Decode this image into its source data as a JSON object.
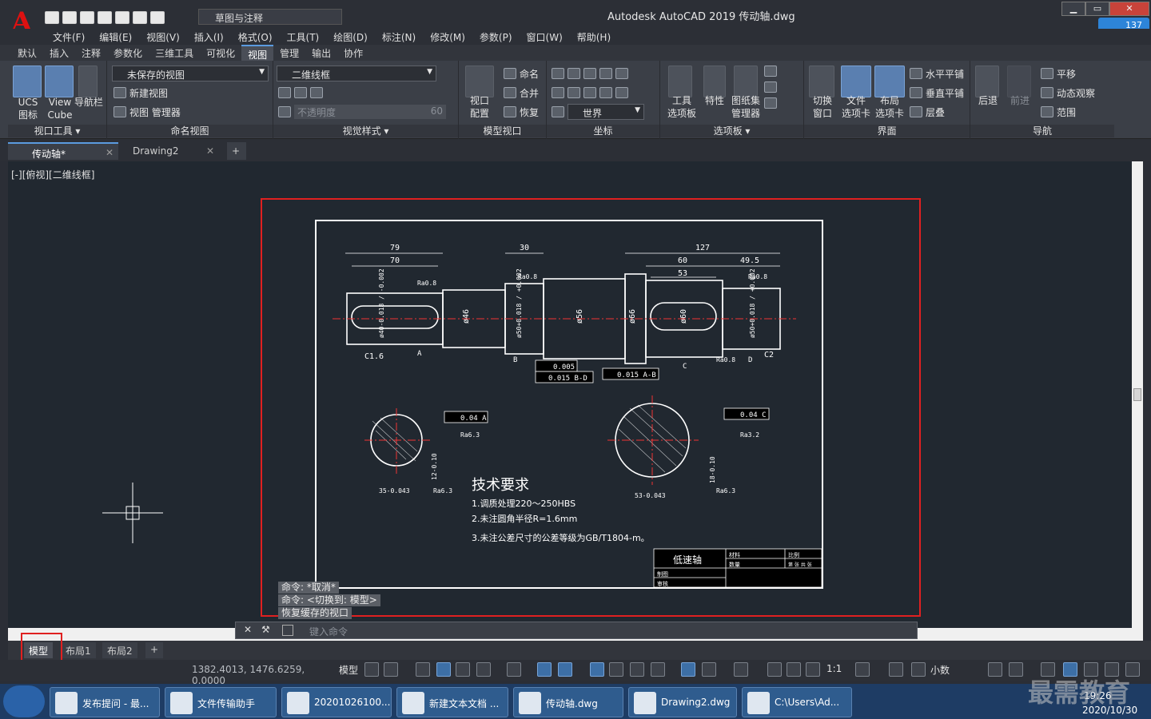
{
  "app": {
    "logo": "A",
    "workspace": "草图与注释",
    "title": "Autodesk AutoCAD 2019    传动轴.dwg",
    "cloud_count": "137"
  },
  "menu": [
    "文件(F)",
    "编辑(E)",
    "视图(V)",
    "插入(I)",
    "格式(O)",
    "工具(T)",
    "绘图(D)",
    "标注(N)",
    "修改(M)",
    "参数(P)",
    "窗口(W)",
    "帮助(H)"
  ],
  "ribbon_tabs": [
    "默认",
    "插入",
    "注释",
    "参数化",
    "三维工具",
    "可视化",
    "视图",
    "管理",
    "输出",
    "协作"
  ],
  "ribbon": {
    "viewport_tools": {
      "title": "视口工具 ▾",
      "ucs1": "UCS",
      "ucs2": "图标",
      "vc1": "View",
      "vc2": "Cube",
      "nav": "导航栏"
    },
    "named_views": {
      "title": "命名视图",
      "combo": "未保存的视图",
      "new_view": "新建视图",
      "view_manager": "视图 管理器"
    },
    "visual_styles": {
      "title": "视觉样式 ▾",
      "combo": "二维线框",
      "transparency": "不透明度",
      "transparency_value": "60"
    },
    "model_viewports": {
      "title": "模型视口",
      "config1": "视口",
      "config2": "配置",
      "name": "命名",
      "join": "合并",
      "restore": "恢复"
    },
    "coordinates": {
      "title": "坐标",
      "world": "世界"
    },
    "palettes": {
      "title": "选项板 ▾",
      "tool1": "工具",
      "tool2": "选项板",
      "props": "特性",
      "sheet1": "图纸集",
      "sheet2": "管理器"
    },
    "interface": {
      "title": "界面",
      "switch1": "切换",
      "switch2": "窗口",
      "file1": "文件",
      "file2": "选项卡",
      "layout1": "布局",
      "layout2": "选项卡",
      "tile_h": "水平平铺",
      "tile_v": "垂直平铺",
      "cascade": "层叠"
    },
    "navigate": {
      "title": "导航",
      "back": "后退",
      "forward": "前进",
      "pan": "平移",
      "orbit": "动态观察",
      "extents": "范围"
    }
  },
  "doc_tabs": [
    "传动轴*",
    "Drawing2"
  ],
  "view_label": "[-][俯视][二维线框]",
  "drawing": {
    "dims": {
      "d79": "79",
      "d70": "70",
      "d30": "30",
      "d127": "127",
      "d60": "60",
      "d49_5": "49.5",
      "d53": "53",
      "c16": "C1.6",
      "c2": "C2",
      "phi46": "ø46",
      "phi56": "ø56",
      "phi66": "ø66",
      "phi60": "ø60",
      "phi40": "ø40-0.018 / -0.002",
      "phi50a": "ø50+0.018 / +0.002",
      "phi50b": "ø50+0.018 / +0.002",
      "rough": "Ra0.8",
      "rough2": "Ra6.3",
      "rough3": "Ra3.2",
      "tol1": "0.005",
      "tol2": "0.015 B-D",
      "tol3": "0.015 A-B",
      "tol4": "0.04 A",
      "tol5": "0.04 C",
      "sec1_w": "12-0.10",
      "sec1_d": "35-0.043",
      "sec2_w": "18-0.10",
      "sec2_d": "53-0.043",
      "datum_a": "A",
      "datum_b": "B",
      "datum_c": "C",
      "datum_d": "D"
    },
    "tech_title": "技术要求",
    "tech_notes": [
      "1.调质处理220～250HBS",
      "2.未注圆角半径R=1.6mm",
      "3.未注公差尺寸的公差等级为GB/T1804-m。"
    ],
    "title_block": {
      "name": "低速轴",
      "c1": "材料",
      "c2": "数量",
      "c3": "比例",
      "c4": "第 张 共 张",
      "c5": "制图",
      "c6": "审核"
    }
  },
  "command": {
    "history": [
      "命令: *取消*",
      "命令:   <切换到: 模型>",
      "恢复缓存的视口"
    ],
    "placeholder": "键入命令"
  },
  "layout_tabs": [
    "模型",
    "布局1",
    "布局2"
  ],
  "status": {
    "coords": "1382.4013, 1476.6259, 0.0000",
    "model": "模型",
    "scale": "1:1",
    "units": "小数"
  },
  "taskbar": {
    "buttons": [
      "发布提问 - 最...",
      "文件传输助手",
      "20201026100...",
      "新建文本文档 ...",
      "传动轴.dwg",
      "Drawing2.dwg",
      "C:\\Users\\Ad..."
    ],
    "time": "19:26",
    "date": "2020/10/30"
  },
  "watermark": "最需教育",
  "colors": {
    "canvas": "#212830",
    "highlight": "#e02020",
    "accent": "#5b9be0",
    "taskbar": "#1e3c64"
  }
}
